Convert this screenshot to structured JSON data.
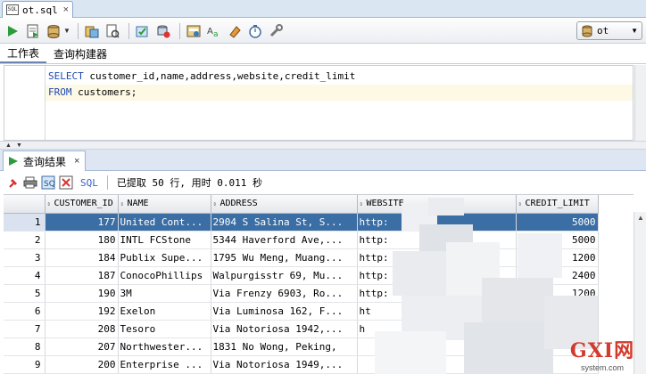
{
  "file_tab": {
    "label": "ot.sql",
    "close": "×",
    "file_icon_text": "SQL"
  },
  "toolbar": {
    "icons": [
      "run-statement-icon",
      "run-script-icon",
      "commit-icon",
      "rollback-icon",
      "autotrace-icon",
      "explain-plan-icon",
      "sql-tuning-icon",
      "clear-icon",
      "sql-history-icon",
      "format-icon",
      "eraser-icon",
      "stopwatch-icon",
      "tools-icon"
    ],
    "connection": "ot"
  },
  "sub_tabs": [
    "工作表",
    "查询构建器"
  ],
  "editor": {
    "line1": {
      "kw": "SELECT",
      "rest": " customer_id,name,address,website,credit_limit",
      "name_kw": "name"
    },
    "line2": {
      "kw": "FROM",
      "rest": " customers;"
    }
  },
  "results_tab": {
    "label": "查询结果",
    "close": "×"
  },
  "results_toolbar": {
    "sql_label": "SQL",
    "status": "已提取 50 行, 用时 0.011 秒"
  },
  "grid": {
    "columns": [
      "CUSTOMER_ID",
      "NAME",
      "ADDRESS",
      "WEBSITE",
      "CREDIT_LIMIT"
    ],
    "rows": [
      {
        "n": "1",
        "id": "177",
        "name": "United Cont...",
        "address": "2904 S Salina St, S...",
        "website": "http:",
        "credit": "5000"
      },
      {
        "n": "2",
        "id": "180",
        "name": "INTL FCStone",
        "address": "5344 Haverford Ave,...",
        "website": "http:",
        "credit": "5000"
      },
      {
        "n": "3",
        "id": "184",
        "name": "Publix Supe...",
        "address": "1795 Wu Meng, Muang...",
        "website": "http:",
        "credit": "1200"
      },
      {
        "n": "4",
        "id": "187",
        "name": "ConocoPhillips",
        "address": "Walpurgisstr 69, Mu...",
        "website": "http:",
        "credit": "2400"
      },
      {
        "n": "5",
        "id": "190",
        "name": "3M",
        "address": "Via Frenzy 6903, Ro...",
        "website": "http:",
        "credit": "1200"
      },
      {
        "n": "6",
        "id": "192",
        "name": "Exelon",
        "address": "Via Luminosa 162, F...",
        "website": "ht",
        "credit": "500"
      },
      {
        "n": "7",
        "id": "208",
        "name": "Tesoro",
        "address": "Via Notoriosa 1942,...",
        "website": "h",
        "credit": ""
      },
      {
        "n": "8",
        "id": "207",
        "name": "Northwester...",
        "address": "1831 No Wong, Peking,",
        "website": "",
        "credit": ""
      },
      {
        "n": "9",
        "id": "200",
        "name": "Enterprise ...",
        "address": "Via Notoriosa 1949,...",
        "website": "",
        "credit": ""
      }
    ]
  },
  "watermark": {
    "big": "GXI网",
    "small": "system.com"
  },
  "colors": {
    "accent": "#3a6ea5",
    "keyword": "#1f48b0",
    "line_highlight": "#fdf9e4",
    "watermark": "#d23b2c"
  }
}
